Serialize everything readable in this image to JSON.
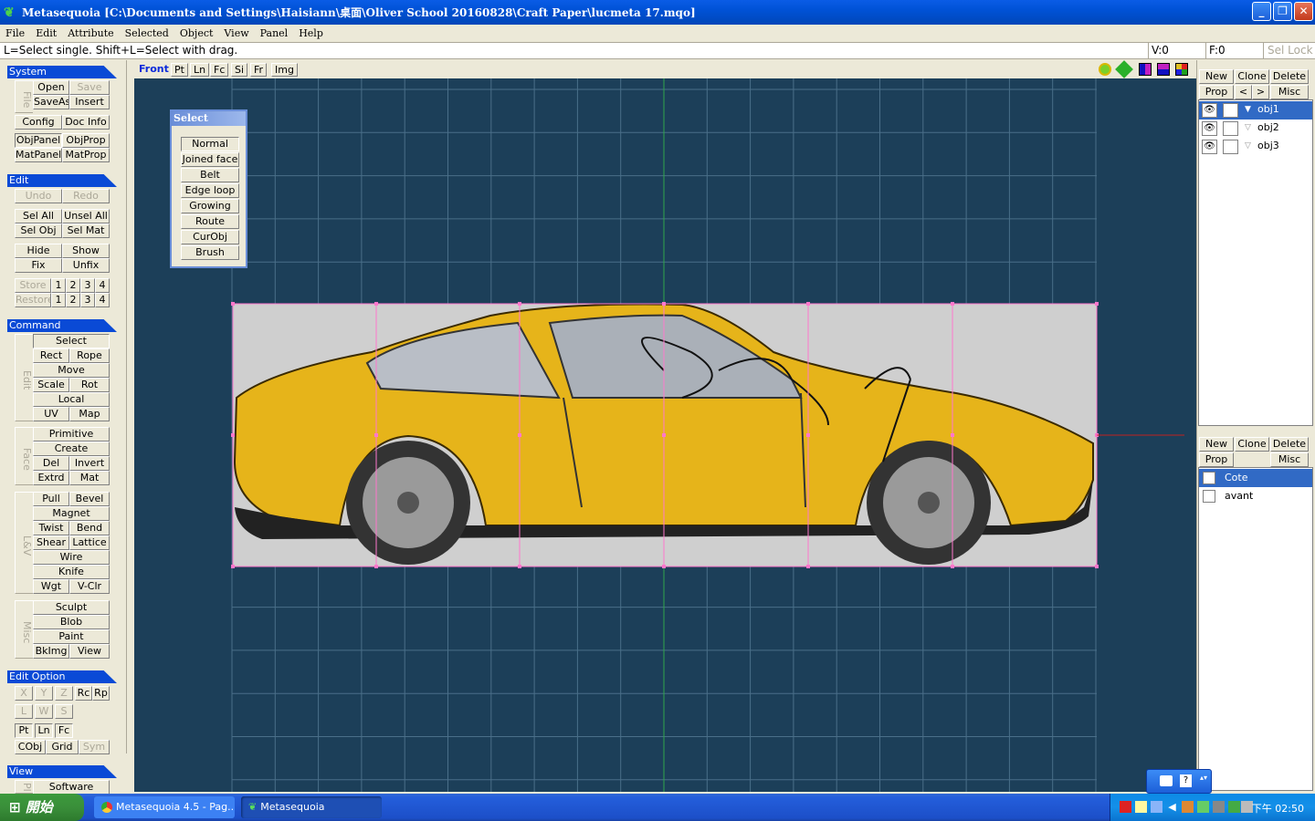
{
  "window": {
    "title": "Metasequoia [C:\\Documents and Settings\\Haisiann\\桌面\\Oliver School 20160828\\Craft Paper\\lucmeta 17.mqo]",
    "app_icon": "sequoia-leaf-icon",
    "minimize": "_",
    "maximize": "❐",
    "close": "✕"
  },
  "menu": [
    "File",
    "Edit",
    "Attribute",
    "Selected",
    "Object",
    "View",
    "Panel",
    "Help"
  ],
  "status": {
    "hint": "L=Select single.  Shift+L=Select with drag.",
    "vertices": "V:0",
    "faces": "F:0",
    "sel_lock": "Sel Lock"
  },
  "left_panel": {
    "system": {
      "title": "System",
      "file_group": "File",
      "open": "Open",
      "save": "Save",
      "saveas": "SaveAs",
      "insert": "Insert",
      "config": "Config",
      "docinfo": "Doc Info",
      "objpanel": "ObjPanel",
      "objprop": "ObjProp",
      "matpanel": "MatPanel",
      "matprop": "MatProp"
    },
    "edit": {
      "title": "Edit",
      "undo": "Undo",
      "redo": "Redo",
      "selall": "Sel All",
      "unselall": "Unsel All",
      "selobj": "Sel Obj",
      "selmat": "Sel Mat",
      "hide": "Hide",
      "show": "Show",
      "fix": "Fix",
      "unfix": "Unfix",
      "store": "Store",
      "restore": "Restore",
      "n1": "1",
      "n2": "2",
      "n3": "3",
      "n4": "4"
    },
    "command": {
      "title": "Command",
      "edit_group": "Edit",
      "select": "Select",
      "rect": "Rect",
      "rope": "Rope",
      "move": "Move",
      "scale": "Scale",
      "rot": "Rot",
      "local": "Local",
      "uv": "UV",
      "map": "Map",
      "face_group": "Face",
      "primitive": "Primitive",
      "create": "Create",
      "del": "Del",
      "invert": "Invert",
      "extrd": "Extrd",
      "mat": "Mat",
      "lv_group": "L&V",
      "pull": "Pull",
      "bevel": "Bevel",
      "magnet": "Magnet",
      "twist": "Twist",
      "bend": "Bend",
      "shear": "Shear",
      "lattice": "Lattice",
      "wire": "Wire",
      "knife": "Knife",
      "wgt": "Wgt",
      "vclr": "V-Clr",
      "misc_group": "Misc",
      "sculpt": "Sculpt",
      "blob": "Blob",
      "paint": "Paint",
      "bkimg": "BkImg",
      "view": "View"
    },
    "edit_option": {
      "title": "Edit Option",
      "x": "X",
      "y": "Y",
      "z": "Z",
      "rc": "Rc",
      "rp": "Rp",
      "l": "L",
      "w": "W",
      "s": "S",
      "pt": "Pt",
      "ln": "Ln",
      "fc": "Fc",
      "cobj": "CObj",
      "grid": "Grid",
      "sym": "Sym"
    },
    "view_section": {
      "title": "View",
      "p_group": "Pl",
      "software": "Software"
    }
  },
  "view_tabs": [
    "Front",
    "Pt",
    "Ln",
    "Fc",
    "Si",
    "Fr",
    "Img"
  ],
  "view_tools": [
    "zoom-icon",
    "move-view-icon",
    "color-mode-icon-1",
    "color-mode-icon-2",
    "color-mode-icon-3"
  ],
  "select_window": {
    "title": "Select",
    "items": [
      "Normal",
      "Joined face",
      "Belt",
      "Edge loop",
      "Growing",
      "Route",
      "CurObj",
      "Brush"
    ]
  },
  "object_panel": {
    "new": "New",
    "clone": "Clone",
    "delete": "Delete",
    "prop": "Prop",
    "prev": "<",
    "next": ">",
    "misc": "Misc",
    "objects": [
      {
        "name": "obj1",
        "selected": true,
        "expanded": true
      },
      {
        "name": "obj2",
        "selected": false,
        "expanded": false
      },
      {
        "name": "obj3",
        "selected": false,
        "expanded": false
      }
    ]
  },
  "material_panel": {
    "new": "New",
    "clone": "Clone",
    "delete": "Delete",
    "prop": "Prop",
    "misc": "Misc",
    "materials": [
      {
        "name": "Cote",
        "selected": true
      },
      {
        "name": "avant",
        "selected": false
      }
    ]
  },
  "taskbar": {
    "start": "開始",
    "tasks": [
      {
        "label": "Metasequoia 4.5 - Pag...",
        "icon": "chrome-icon"
      },
      {
        "label": "Metasequoia",
        "icon": "sequoia-leaf-icon"
      }
    ],
    "clock": "下午 02:50"
  },
  "colors": {
    "viewport_bg": "#1c3f59",
    "grid": "#4a6f89",
    "selection_box": "#ff77cc",
    "car_body": "#e6b41a"
  }
}
